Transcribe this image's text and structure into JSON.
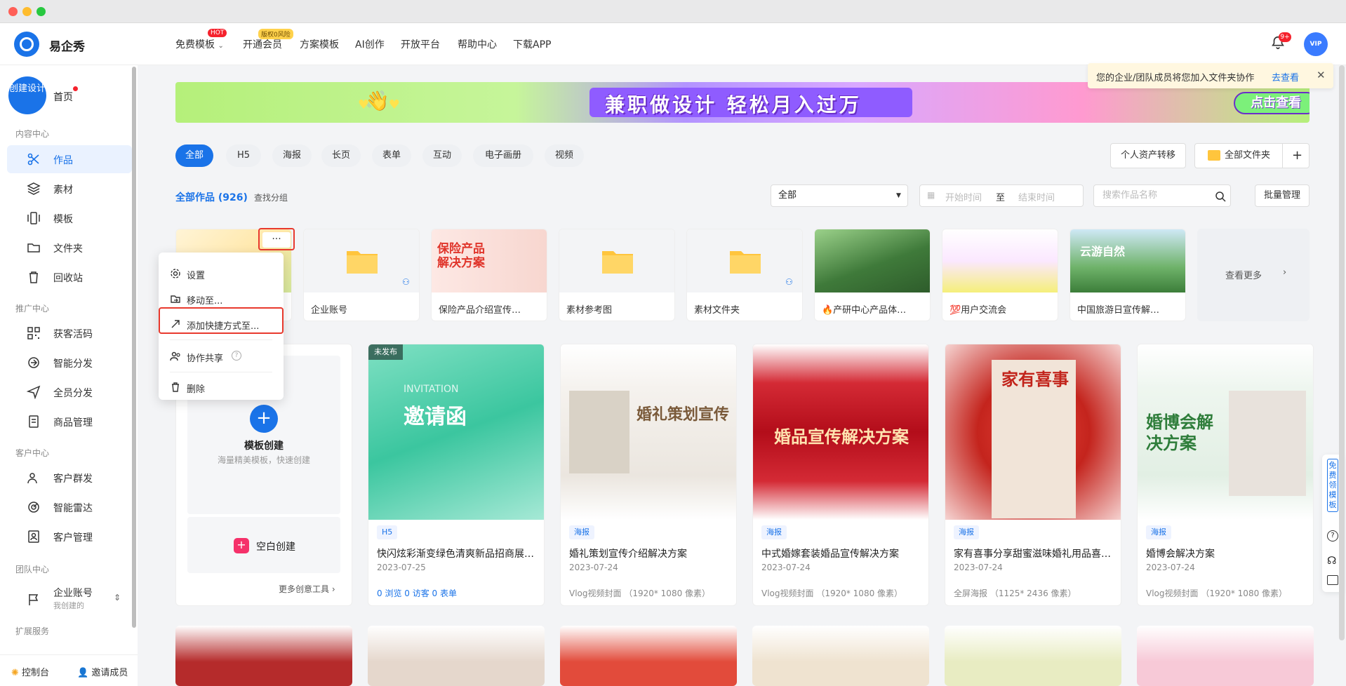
{
  "brand": {
    "name": "易企秀"
  },
  "topnav": {
    "items": [
      {
        "label": "免费模板",
        "badge": "HOT",
        "has_caret": true
      },
      {
        "label": "开通会员",
        "badge": "版权0风险"
      },
      {
        "label": "方案模板"
      },
      {
        "label": "AI创作"
      },
      {
        "label": "开放平台"
      },
      {
        "label": "帮助中心"
      },
      {
        "label": "下载APP"
      }
    ],
    "notif_count": "9+",
    "vip_label": "VIP"
  },
  "sidebar": {
    "create_label": "创建设计",
    "home_label": "首页",
    "sections": [
      {
        "title": "内容中心",
        "items": [
          {
            "label": "作品",
            "icon": "scissors-icon",
            "active": true
          },
          {
            "label": "素材",
            "icon": "layers-icon"
          },
          {
            "label": "模板",
            "icon": "template-icon"
          },
          {
            "label": "文件夹",
            "icon": "folder-icon"
          },
          {
            "label": "回收站",
            "icon": "trash-icon"
          }
        ]
      },
      {
        "title": "推广中心",
        "items": [
          {
            "label": "获客活码",
            "icon": "qrcode-icon"
          },
          {
            "label": "智能分发",
            "icon": "distribute-icon"
          },
          {
            "label": "全员分发",
            "icon": "send-icon"
          },
          {
            "label": "商品管理",
            "icon": "product-icon"
          }
        ]
      },
      {
        "title": "客户中心",
        "items": [
          {
            "label": "客户群发",
            "icon": "users-icon"
          },
          {
            "label": "智能雷达",
            "icon": "radar-icon"
          },
          {
            "label": "客户管理",
            "icon": "contact-icon"
          }
        ]
      },
      {
        "title": "团队中心",
        "items": [
          {
            "label": "企业账号",
            "sub": "我创建的",
            "icon": "flag-icon"
          }
        ]
      },
      {
        "title": "扩展服务",
        "items": []
      }
    ],
    "bottom": {
      "console": "控制台",
      "invite": "邀请成员"
    }
  },
  "notice": {
    "text": "您的企业/团队成员将您加入文件夹协作",
    "link": "去查看"
  },
  "banner": {
    "text": "兼职做设计 轻松月入过万",
    "cta": "点击查看"
  },
  "tabs": [
    "全部",
    "H5",
    "海报",
    "长页",
    "表单",
    "互动",
    "电子画册",
    "视频"
  ],
  "actions": {
    "transfer": "个人资产转移",
    "all_folders": "全部文件夹"
  },
  "filter": {
    "title": "全部作品 (926)",
    "find_group": "查找分组",
    "select_value": "全部",
    "date_start": "开始时间",
    "date_to": "至",
    "date_end": "结束时间",
    "search_placeholder": "搜索作品名称",
    "batch": "批量管理"
  },
  "folders": [
    {
      "name": "",
      "thumb": "image"
    },
    {
      "name": "企业账号",
      "thumb": "folder"
    },
    {
      "name": "保险产品介绍宣传…",
      "thumb": "image"
    },
    {
      "name": "素材参考图",
      "thumb": "folder"
    },
    {
      "name": "素材文件夹",
      "thumb": "folder"
    },
    {
      "name": "🔥产研中心产品体…",
      "thumb": "image"
    },
    {
      "name": "💯用户交流会",
      "thumb": "image"
    },
    {
      "name": "中国旅游日宣传解…",
      "thumb": "image"
    }
  ],
  "see_more": "查看更多",
  "create_card": {
    "template_title": "模板创建",
    "template_sub": "海量精美模板，快速创建",
    "blank": "空白创建",
    "more_tools": "更多创意工具"
  },
  "cards": [
    {
      "tag": "未发布",
      "badge": "H5",
      "title": "快闪炫彩渐变绿色清爽新品招商展…",
      "date": "2023-07-25",
      "meta": "0 浏览   0 访客   0 表单",
      "thumb_color": "#4fcfa9",
      "thumb_text": "邀请函"
    },
    {
      "badge": "海报",
      "title": "婚礼策划宣传介绍解决方案",
      "date": "2023-07-24",
      "meta": "Vlog视频封面  （1920* 1080 像素）",
      "thumb_color": "#f0ede8",
      "thumb_text": "婚礼策划宣传"
    },
    {
      "badge": "海报",
      "title": "中式婚嫁套装婚品宣传解决方案",
      "date": "2023-07-24",
      "meta": "Vlog视频封面  （1920* 1080 像素）",
      "thumb_color": "#c0101c",
      "thumb_text": "婚品宣传解决方案"
    },
    {
      "badge": "海报",
      "title": "家有喜事分享甜蜜滋味婚礼用品喜…",
      "date": "2023-07-24",
      "meta": "全屏海报  （1125* 2436 像素）",
      "thumb_color": "#d8352a",
      "thumb_text": "家有喜事"
    },
    {
      "badge": "海报",
      "title": "婚博会解决方案",
      "date": "2023-07-24",
      "meta": "Vlog视频封面  （1920* 1080 像素）",
      "thumb_color": "#eef5ef",
      "thumb_text": "婚博会解决方案"
    }
  ],
  "context_menu": {
    "items": [
      {
        "label": "设置",
        "icon": "gear-icon"
      },
      {
        "label": "移动至...",
        "icon": "move-icon"
      },
      {
        "label": "添加快捷方式至...",
        "icon": "shortcut-icon"
      },
      {
        "label": "协作共享",
        "icon": "share-users-icon"
      },
      {
        "label": "删除",
        "icon": "trash-icon"
      }
    ],
    "more_label": "···"
  },
  "right_float": {
    "label": "免费领模板"
  },
  "colors": {
    "primary": "#1a73e8",
    "danger": "#e8392d",
    "hot": "#f5222d"
  }
}
